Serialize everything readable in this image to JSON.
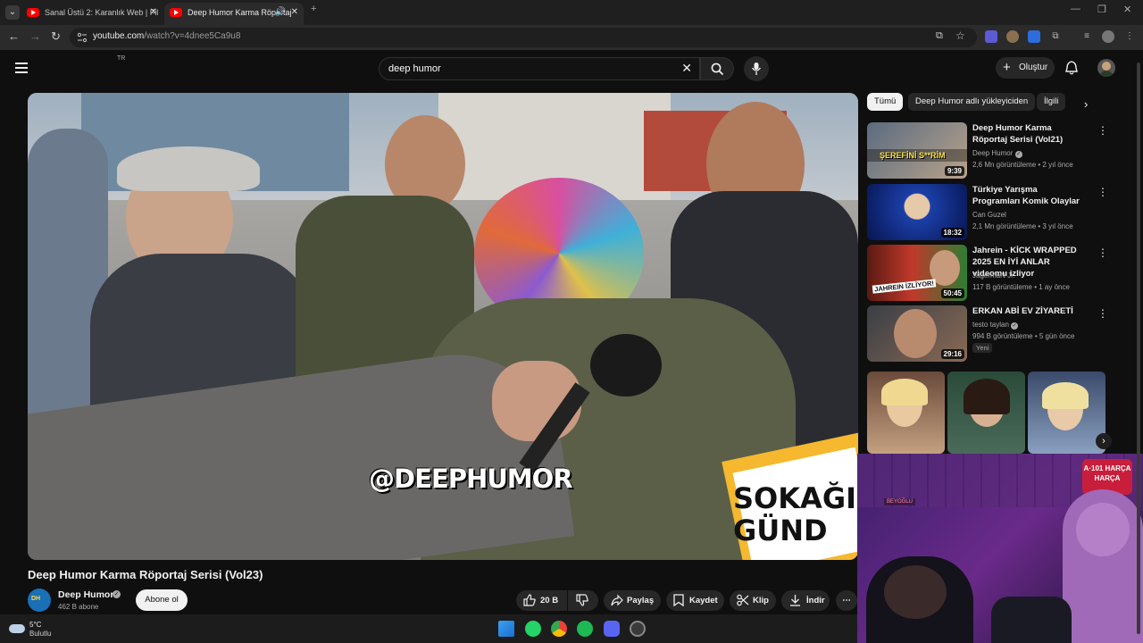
{
  "browser": {
    "tabs": [
      {
        "title": "Sanal Üstü 2: Karanlık Web | Fil"
      },
      {
        "title": "Deep Humor Karma Röportaj"
      }
    ],
    "url_host": "youtube.com",
    "url_path": "/watch?v=4dnee5Ca9u8"
  },
  "masthead": {
    "region": "TR",
    "search_value": "deep humor",
    "create_label": "Oluştur"
  },
  "video": {
    "overlay_handle": "@DEEPHUMOR",
    "overlay_logo_top": "SOKAĞI",
    "overlay_logo_bottom": "GÜND",
    "title": "Deep Humor Karma Röportaj Serisi (Vol23)",
    "channel_name": "Deep Humor",
    "subscribers": "462 B abone",
    "subscribe_label": "Abone ol",
    "likes": "20 B",
    "share_label": "Paylaş",
    "save_label": "Kaydet",
    "clip_label": "Klip",
    "download_label": "İndir"
  },
  "sidebar": {
    "chips": [
      "Tümü",
      "Deep Humor adlı yükleyiciden",
      "İlgili"
    ],
    "related": [
      {
        "title": "Deep Humor Karma Röportaj Serisi (Vol21)",
        "channel": "Deep Humor",
        "meta": "2,6 Mn görüntüleme • 2 yıl önce",
        "duration": "9:39",
        "thumb_text": "ŞEREFİNİ S**RİM"
      },
      {
        "title": "Türkiye Yarışma Programları Komik Olaylar",
        "channel": "Can Guzel",
        "meta": "2,1 Mn görüntüleme • 3 yıl önce",
        "duration": "18:32"
      },
      {
        "title": "Jahrein - KİCK WRAPPED 2025 EN İYİ ANLAR videomu izliyor",
        "channel": "JagermaN Jr.",
        "meta": "117 B görüntüleme • 1 ay önce",
        "duration": "50:45",
        "thumb_text": "JAHREIN İZLİYOR!"
      },
      {
        "title": "ERKAN ABİ EV ZİYARETİ",
        "channel": "testo taylan",
        "meta": "994 B görüntüleme • 5 gün önce",
        "badge": "Yeni",
        "duration": "29:16"
      }
    ]
  },
  "webcam": {
    "sign": "A·101 HARÇA HARÇA",
    "street_sign": "BEYOĞLU"
  },
  "taskbar": {
    "temp": "5°C",
    "weather": "Bulutlu"
  },
  "colors": {
    "youtube_red": "#ff0000",
    "bg": "#0f0f0f",
    "chip_bg": "#272727"
  }
}
